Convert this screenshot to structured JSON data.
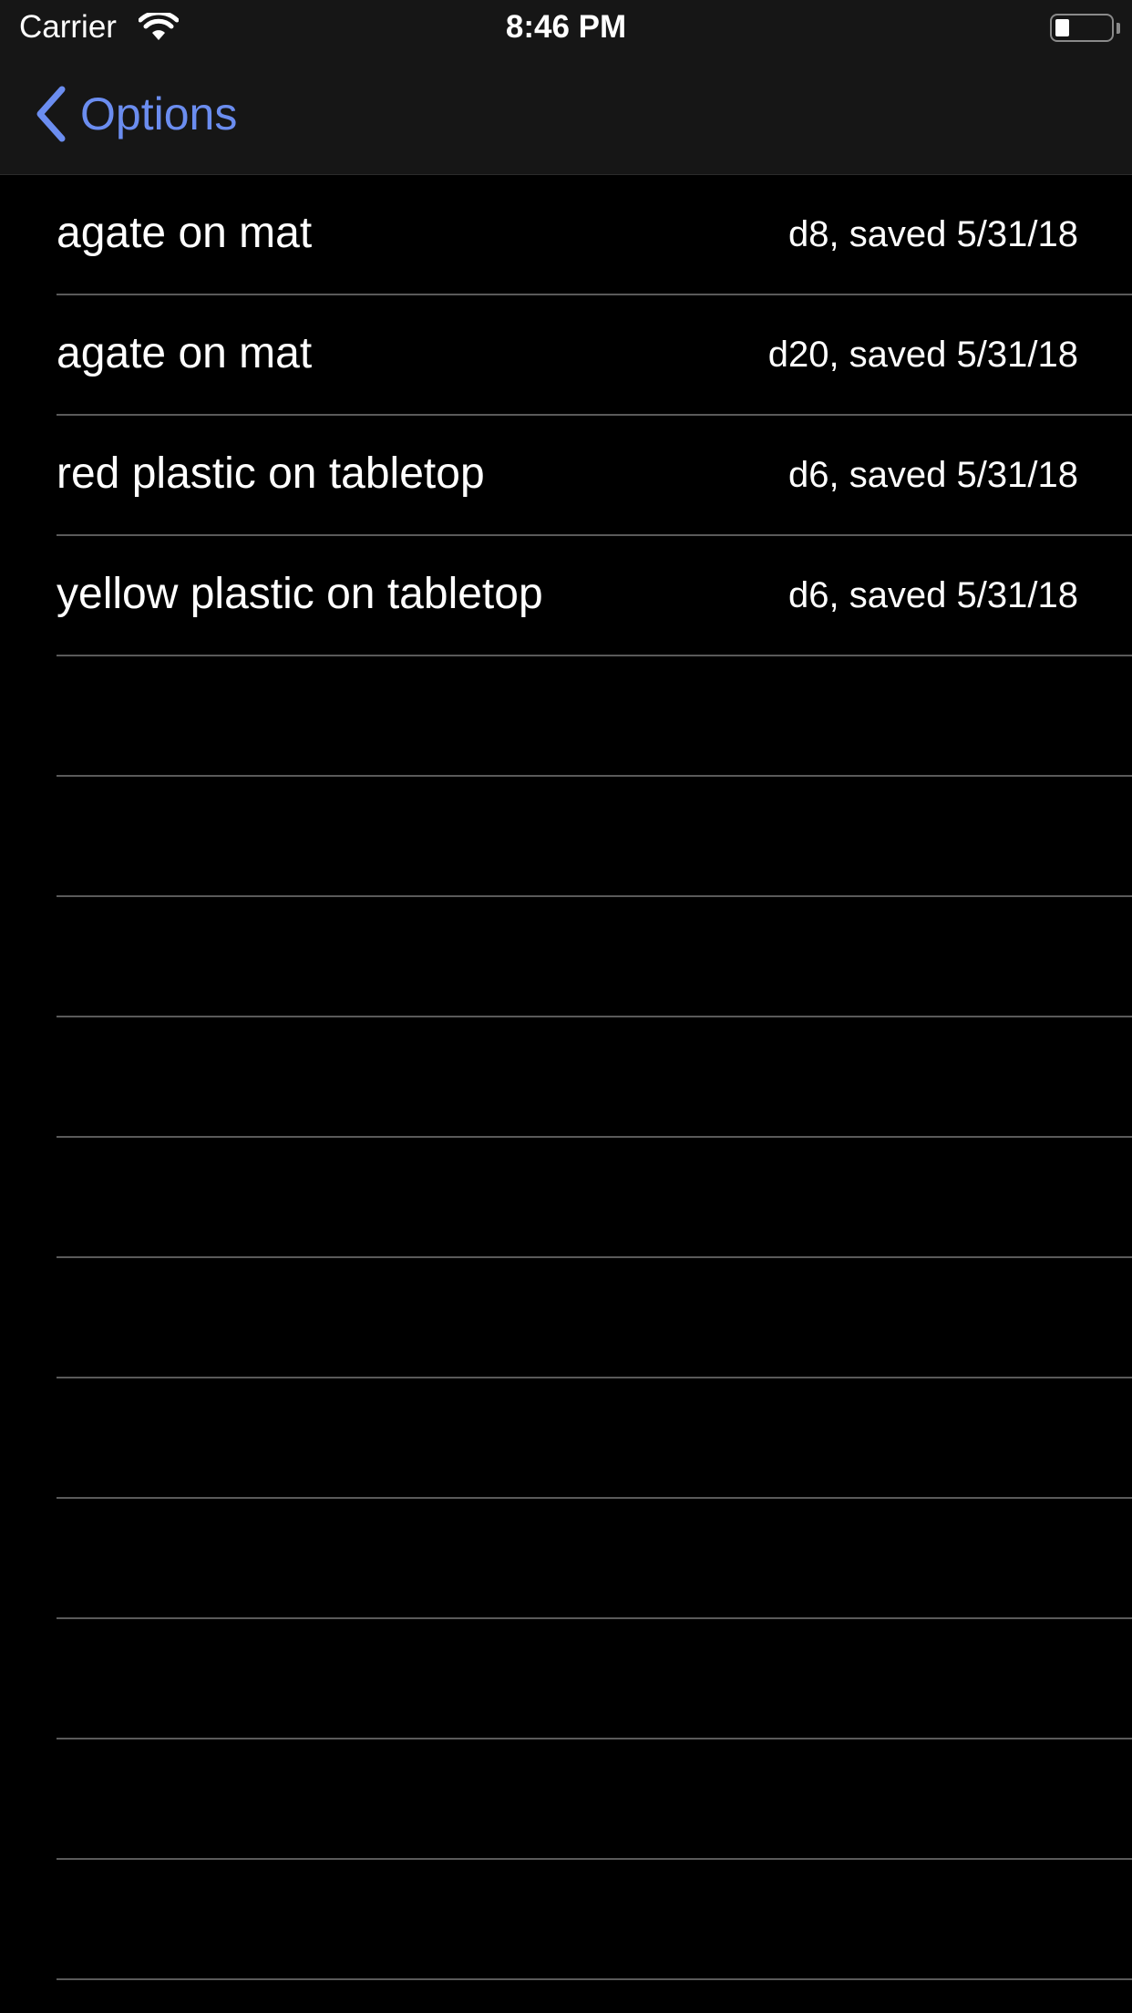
{
  "status_bar": {
    "carrier": "Carrier",
    "time": "8:46 PM",
    "battery_level": 0.25
  },
  "nav": {
    "back_label": "Options",
    "accent_color": "#6b8df0"
  },
  "list": {
    "items": [
      {
        "title": "agate on mat",
        "detail": "d8, saved 5/31/18"
      },
      {
        "title": "agate on mat",
        "detail": "d20, saved 5/31/18"
      },
      {
        "title": "red plastic on tabletop",
        "detail": "d6, saved 5/31/18"
      },
      {
        "title": "yellow plastic on tabletop",
        "detail": "d6, saved 5/31/18"
      }
    ]
  }
}
